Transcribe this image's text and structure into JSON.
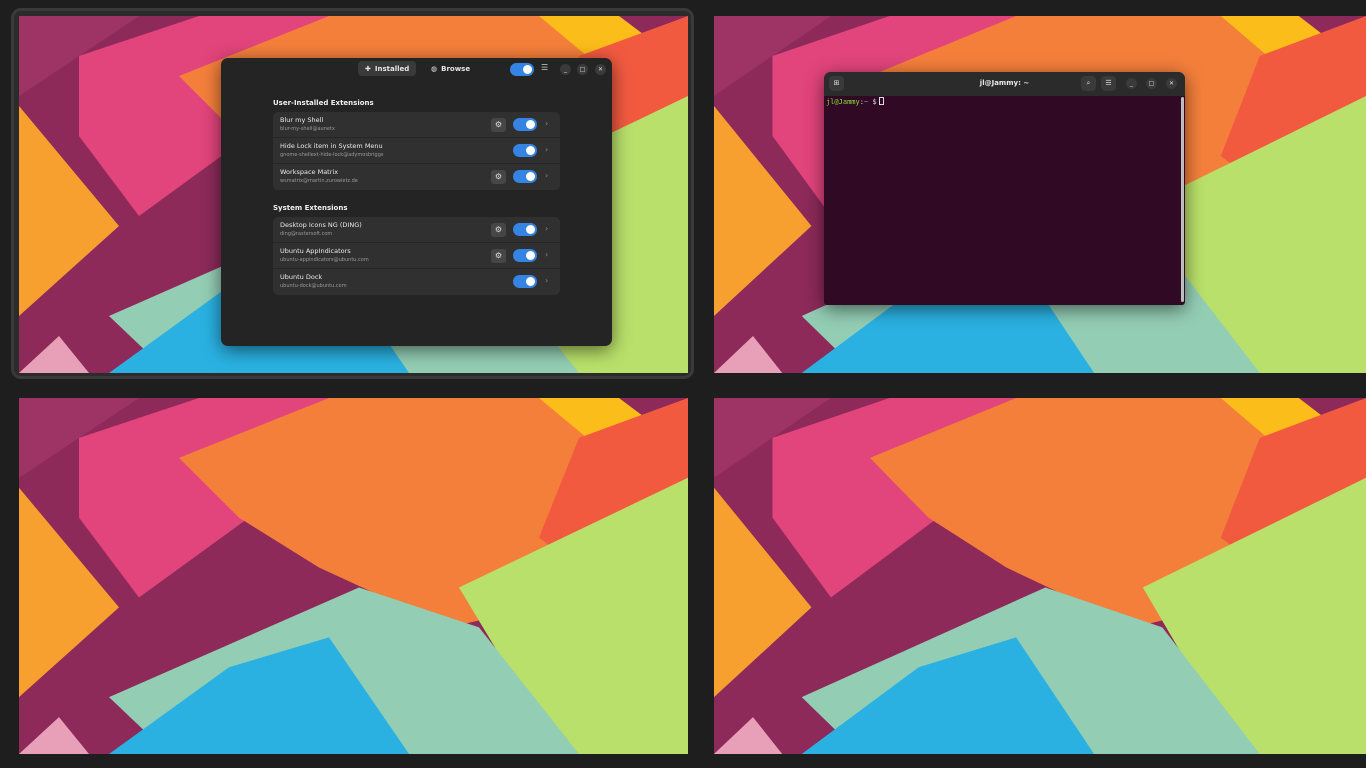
{
  "colors": {
    "accent": "#3584e4",
    "window_bg": "#242424",
    "row_bg": "#303030",
    "terminal_bg": "#300a24",
    "panel_bg": "#1e1e1e"
  },
  "extensions_app": {
    "tabs": [
      {
        "label": "Installed",
        "icon": "puzzle-icon",
        "active": true
      },
      {
        "label": "Browse",
        "icon": "globe-icon",
        "active": false
      }
    ],
    "global_toggle_on": true,
    "sections": [
      {
        "title": "User-Installed Extensions",
        "items": [
          {
            "name": "Blur my Shell",
            "uuid": "blur-my-shell@aunetx",
            "has_settings": true,
            "enabled": true
          },
          {
            "name": "Hide Lock item in System Menu",
            "uuid": "gnome-shellext-hide-lock@adymosbriggs",
            "has_settings": false,
            "enabled": true
          },
          {
            "name": "Workspace Matrix",
            "uuid": "wsmatrix@martin.zurowietz.de",
            "has_settings": true,
            "enabled": true
          }
        ]
      },
      {
        "title": "System Extensions",
        "items": [
          {
            "name": "Desktop Icons NG (DING)",
            "uuid": "ding@rastersoft.com",
            "has_settings": true,
            "enabled": true
          },
          {
            "name": "Ubuntu AppIndicators",
            "uuid": "ubuntu-appindicators@ubuntu.com",
            "has_settings": true,
            "enabled": true
          },
          {
            "name": "Ubuntu Dock",
            "uuid": "ubuntu-dock@ubuntu.com",
            "has_settings": false,
            "enabled": true
          }
        ]
      }
    ]
  },
  "terminal": {
    "title": "jl@Jammy: ~",
    "prompt_user": "jl@Jammy",
    "prompt_sep": ":",
    "prompt_path": "~",
    "prompt_symbol": "$"
  }
}
